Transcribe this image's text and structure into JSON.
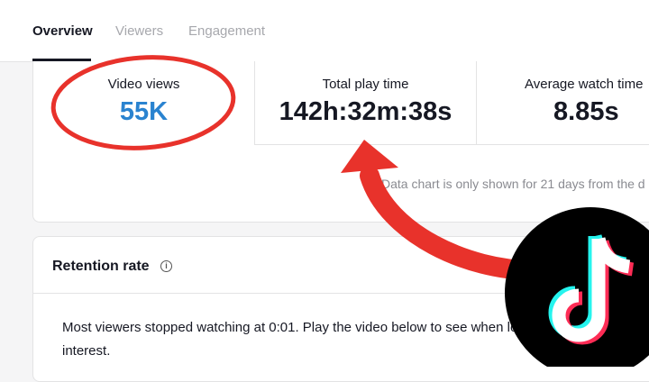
{
  "tabs": [
    {
      "label": "Overview",
      "active": true
    },
    {
      "label": "Viewers",
      "active": false
    },
    {
      "label": "Engagement",
      "active": false
    }
  ],
  "stats": {
    "video_views": {
      "label": "Video views",
      "value": "55K"
    },
    "total_play_time": {
      "label": "Total play time",
      "value": "142h:32m:38s"
    },
    "average_watch_time": {
      "label": "Average watch time",
      "value": "8.85s"
    }
  },
  "chart_note": "Data chart is only shown for 21 days from the d",
  "retention": {
    "title": "Retention rate",
    "text": "Most viewers stopped watching at 0:01. Play the video below to see when lost interest."
  },
  "colors": {
    "highlight_blue": "#2a83d0",
    "annotation_red": "#e8322b",
    "tiktok_cyan": "#25f4ee",
    "tiktok_pink": "#fe2c55"
  },
  "icons": [
    "info-icon",
    "tiktok-logo"
  ]
}
